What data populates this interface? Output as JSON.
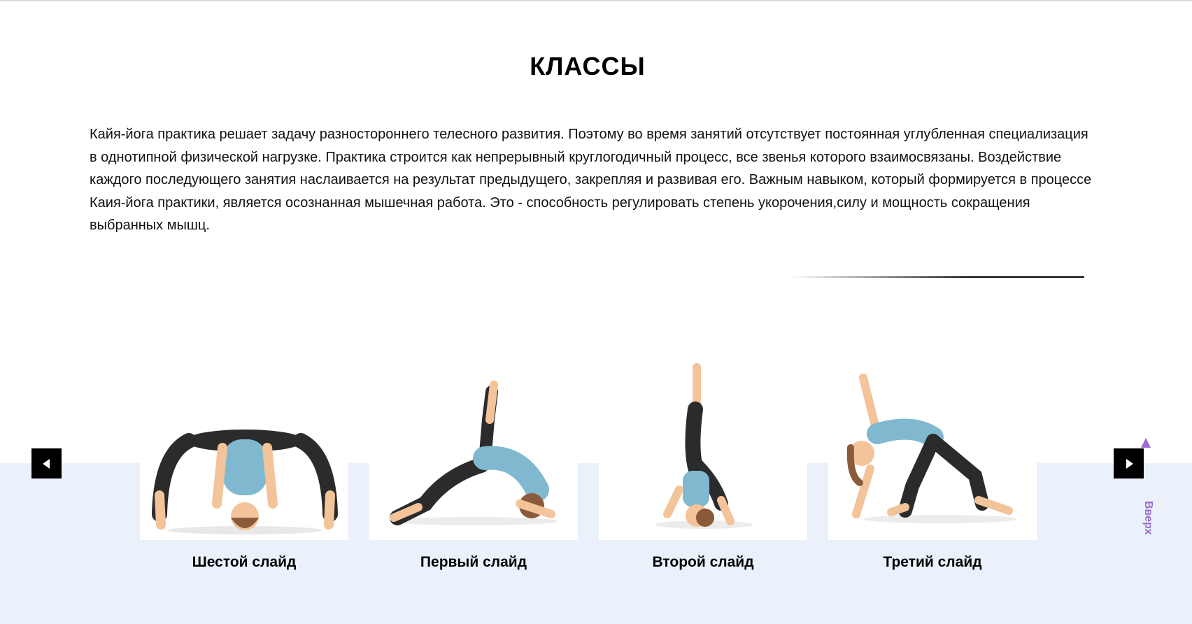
{
  "section": {
    "title": "КЛАССЫ",
    "description": "Кайя-йога практика решает задачу разностороннего телесного развития. Поэтому во время занятий отсутствует постоянная углубленная специализация в однотипной физической нагрузке. Практика строится как непрерывный круглогодичный процесс, все звенья которого взаимосвязаны. Воздействие каждого последующего занятия наслаивается на результат предыдущего, закрепляя и развивая его. Важным навыком, который формируется в процессе Каия-йога практики, является осознанная мышечная работа. Это - способность регулировать степень укорочения,силу и мощность сокращения выбранных мышц."
  },
  "slider": {
    "prev_icon": "arrow-left-icon",
    "next_icon": "arrow-right-icon",
    "slides": [
      {
        "caption": "Шестой слайд",
        "image": "wide-forward-fold-pose"
      },
      {
        "caption": "Первый слайд",
        "image": "bridge-leg-raise-pose"
      },
      {
        "caption": "Второй слайд",
        "image": "shoulder-stand-pose"
      },
      {
        "caption": "Третий слайд",
        "image": "triangle-pose"
      }
    ]
  },
  "scroll_up": {
    "label": "Вверх",
    "icon": "arrow-up-icon"
  },
  "colors": {
    "band": "#eaf1fa",
    "skin": "#f3c39a",
    "top": "#7fb8cf",
    "leggings": "#2b2b2b",
    "hair": "#8a5a3a",
    "up_link": "#9b6bd0"
  }
}
